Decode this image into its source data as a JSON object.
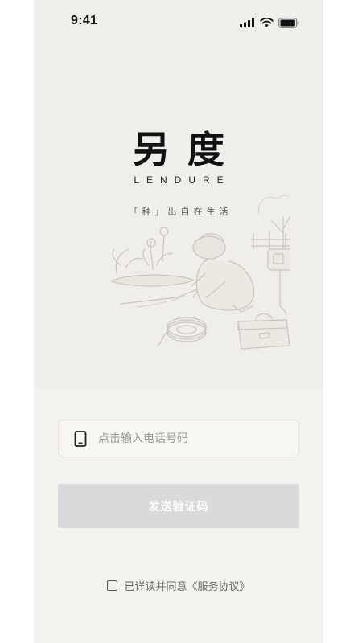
{
  "status_bar": {
    "time": "9:41",
    "icons": [
      "signal-icon",
      "wifi-icon",
      "battery-icon"
    ]
  },
  "brand": {
    "title": "另度",
    "subtitle": "LENDURE",
    "slogan": "「种」出自在生活"
  },
  "login": {
    "phone_placeholder": "点击输入电话号码",
    "phone_value": "",
    "phone_icon": "mobile-phone-icon",
    "send_button_label": "发送验证码",
    "agreement_text": "已详读并同意《服务协议》",
    "agreement_checked": false
  },
  "colors": {
    "upper_background": "#f0eeea",
    "lower_background": "#f3f2ef",
    "button_disabled": "#d8dadc",
    "button_text": "#ffffff"
  }
}
